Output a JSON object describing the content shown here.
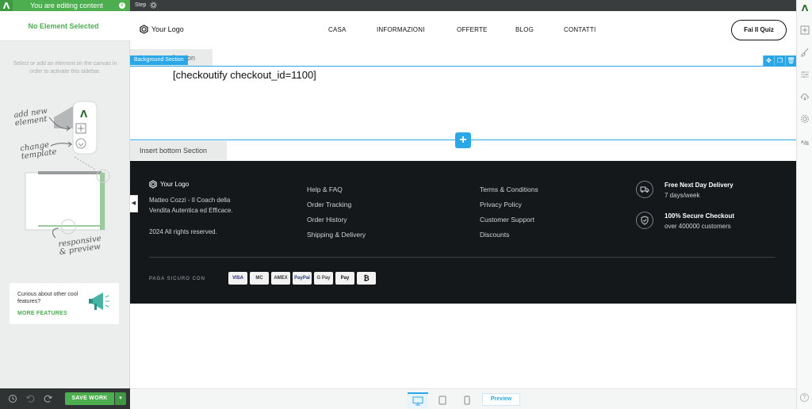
{
  "app": {
    "editing_banner": "You are editing content",
    "info_icon": "info-icon",
    "logo_letter": "Λ"
  },
  "sidebar": {
    "title": "No Element Selected",
    "hint": "Select or add an element on the canvas in order to activate this sidebar.",
    "illustration": {
      "add_new_element": "add new element",
      "change_template": "change template",
      "responsive_preview": "responsive & preview"
    },
    "promo": {
      "text": "Curious about other cool features?",
      "link": "MORE FEATURES"
    },
    "bottom": {
      "save_label": "SAVE WORK"
    }
  },
  "stepbar": {
    "label": "Step"
  },
  "site": {
    "logo": "Your Logo",
    "nav": [
      "CASA",
      "INFORMAZIONI",
      "OFFERTE",
      "BLOG",
      "CONTATTI"
    ],
    "cta": "Fai Il Quiz",
    "section_tab_top": "Insert top Section",
    "background_tag": "Background Section",
    "shortcode": "[checkoutify checkout_id=1100]",
    "section_tab_bottom": "Insert bottom Section"
  },
  "footer": {
    "logo": "Your Logo",
    "description": "Matteo Cozzi - Il Coach della Vendita Autentica ed Efficace.",
    "copyright": "2024 All rights reserved.",
    "col1": [
      "Help & FAQ",
      "Order Tracking",
      "Order History",
      "Shipping & Delivery"
    ],
    "col2": [
      "Terms & Conditions",
      "Privacy Policy",
      "Customer Support",
      "Discounts"
    ],
    "features": [
      {
        "title": "Free Next Day Delivery",
        "subtitle": "7 days/week",
        "icon": "truck-icon"
      },
      {
        "title": "100% Secure Checkout",
        "subtitle": "over 400000 customers",
        "icon": "shield-icon"
      }
    ],
    "pay_label": "PAGA SICURO CON",
    "payments": [
      "VISA",
      "MC",
      "AMEX",
      "PayPal",
      "G Pay",
      "Pay",
      "₿"
    ]
  },
  "previewbar": {
    "preview_label": "Preview"
  }
}
